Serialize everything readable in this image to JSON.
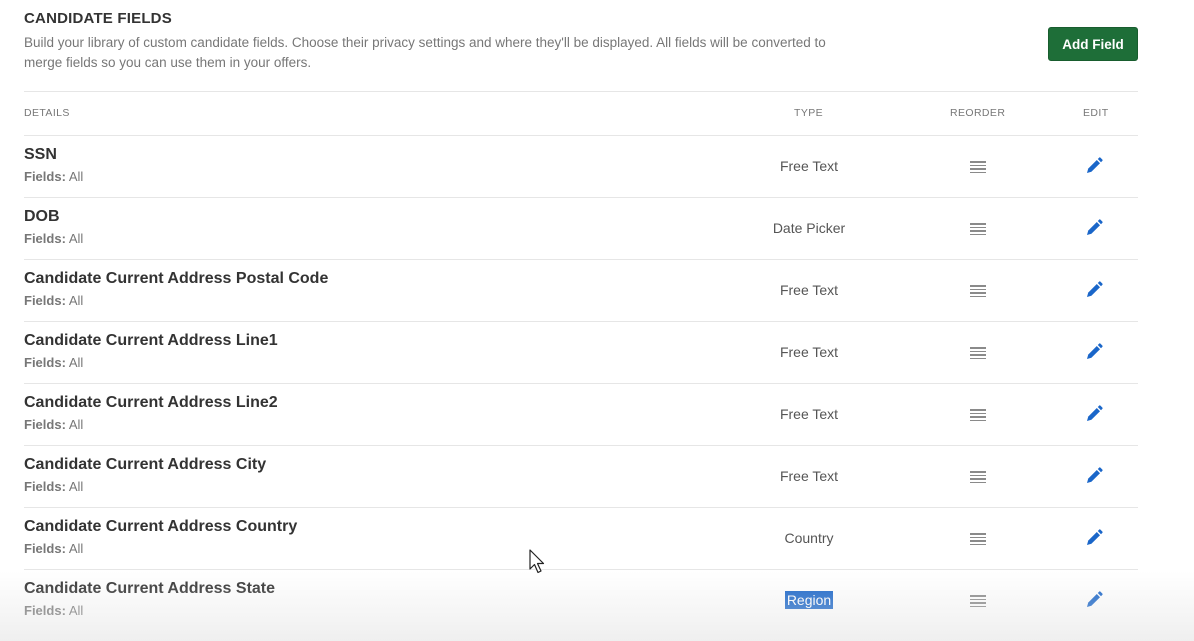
{
  "header": {
    "title": "CANDIDATE FIELDS",
    "description": "Build your library of custom candidate fields. Choose their privacy settings and where they'll be displayed. All fields will be converted to merge fields so you can use them in your offers.",
    "add_button": "Add Field"
  },
  "table": {
    "columns": {
      "details": "DETAILS",
      "type": "TYPE",
      "reorder": "REORDER",
      "edit": "EDIT"
    },
    "fields_label": "Fields:",
    "rows": [
      {
        "name": "SSN",
        "fields": "All",
        "type": "Free Text"
      },
      {
        "name": "DOB",
        "fields": "All",
        "type": "Date Picker"
      },
      {
        "name": "Candidate Current Address Postal Code",
        "fields": "All",
        "type": "Free Text"
      },
      {
        "name": "Candidate Current Address Line1",
        "fields": "All",
        "type": "Free Text"
      },
      {
        "name": "Candidate Current Address Line2",
        "fields": "All",
        "type": "Free Text"
      },
      {
        "name": "Candidate Current Address City",
        "fields": "All",
        "type": "Free Text"
      },
      {
        "name": "Candidate Current Address Country",
        "fields": "All",
        "type": "Country"
      },
      {
        "name": "Candidate Current Address State",
        "fields": "All",
        "type": "Region"
      }
    ]
  },
  "icons": {
    "reorder": "drag-handle-icon",
    "edit": "pencil-icon"
  },
  "colors": {
    "primary_button": "#1e6e38",
    "edit_icon": "#1a66c9",
    "selection": "#1a66c9"
  }
}
